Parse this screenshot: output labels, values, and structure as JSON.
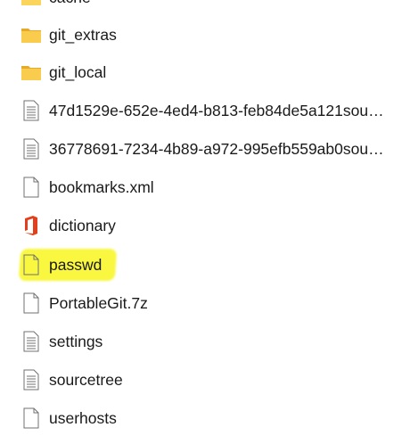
{
  "files": [
    {
      "name": "cache",
      "icon": "folder-icon"
    },
    {
      "name": "git_extras",
      "icon": "folder-icon"
    },
    {
      "name": "git_local",
      "icon": "folder-icon"
    },
    {
      "name": "47d1529e-652e-4ed4-b813-feb84de5a121sou…",
      "icon": "text-file-icon"
    },
    {
      "name": "36778691-7234-4b89-a972-995efb559ab0sou…",
      "icon": "text-file-icon"
    },
    {
      "name": "bookmarks.xml",
      "icon": "blank-file-icon"
    },
    {
      "name": "dictionary",
      "icon": "office-app-icon"
    },
    {
      "name": "passwd",
      "icon": "blank-file-icon"
    },
    {
      "name": "PortableGit.7z",
      "icon": "blank-file-icon"
    },
    {
      "name": "settings",
      "icon": "text-file-icon"
    },
    {
      "name": "sourcetree",
      "icon": "text-file-icon"
    },
    {
      "name": "userhosts",
      "icon": "blank-file-icon"
    }
  ],
  "colors": {
    "folder": "#f4c542",
    "highlight": "#f7f500",
    "office": "#e2401c"
  }
}
